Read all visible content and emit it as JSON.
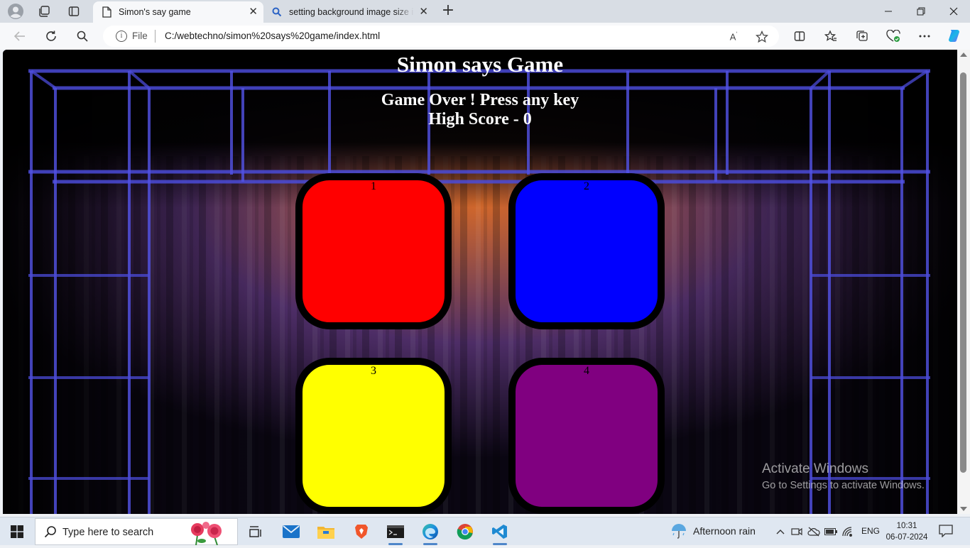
{
  "browser": {
    "tabs": [
      {
        "title": "Simon's say game",
        "icon": "page-icon",
        "active": true
      },
      {
        "title": "setting background image size in",
        "icon": "search-icon",
        "active": false
      }
    ],
    "address": {
      "scheme_label": "File",
      "url": "C:/webtechno/simon%20says%20game/index.html"
    }
  },
  "page": {
    "title": "Simon says Game",
    "status_line1": "Game Over ! Press any key",
    "status_line2": "High Score - 0",
    "buttons": [
      {
        "label": "1",
        "color": "#ff0000"
      },
      {
        "label": "2",
        "color": "#0000ff"
      },
      {
        "label": "3",
        "color": "#ffff00"
      },
      {
        "label": "4",
        "color": "#800080"
      }
    ],
    "activation_watermark": {
      "line1": "Activate Windows",
      "line2": "Go to Settings to activate Windows."
    }
  },
  "taskbar": {
    "search_placeholder": "Type here to search",
    "apps": [
      "task-view-icon",
      "mail-icon",
      "file-explorer-icon",
      "brave-icon",
      "terminal-icon",
      "edge-icon",
      "chrome-icon",
      "vscode-icon"
    ],
    "weather": "Afternoon rain",
    "language": "ENG",
    "time": "10:31",
    "date": "06-07-2024"
  }
}
